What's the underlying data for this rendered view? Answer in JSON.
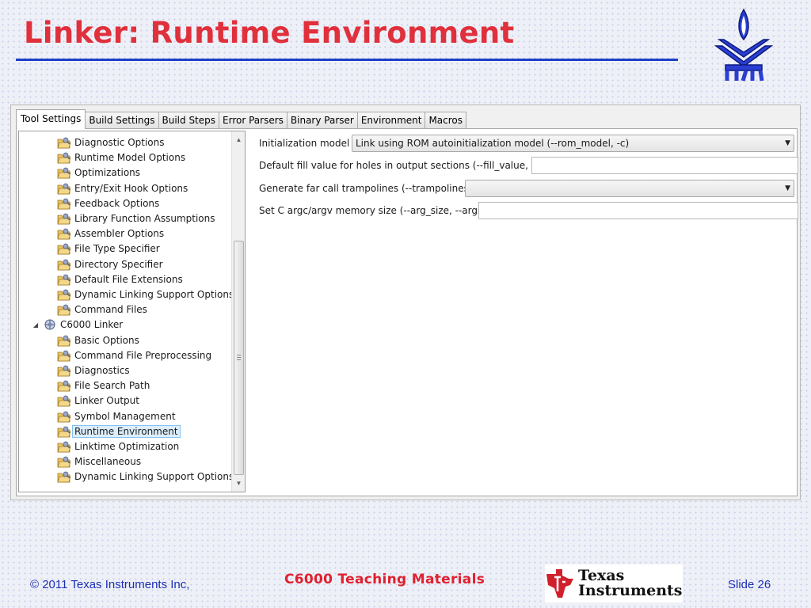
{
  "slide": {
    "title": "Linker: Runtime Environment",
    "footer_left": "© 2011 Texas Instruments Inc,",
    "footer_center": "C6000 Teaching Materials",
    "slide_number": "Slide 26",
    "ti_logo_line1": "Texas",
    "ti_logo_line2": "Instruments",
    "title_color": "#e0303c",
    "rule_color": "#1b3fc7"
  },
  "tabs": [
    {
      "label": "Tool Settings",
      "active": true
    },
    {
      "label": "Build Settings"
    },
    {
      "label": "Build Steps"
    },
    {
      "label": "Error Parsers"
    },
    {
      "label": "Binary Parser"
    },
    {
      "label": "Environment"
    },
    {
      "label": "Macros"
    }
  ],
  "tree": {
    "items": [
      {
        "label": "Diagnostic Options",
        "icon": "options-folder-icon"
      },
      {
        "label": "Runtime Model Options",
        "icon": "options-folder-icon"
      },
      {
        "label": "Optimizations",
        "icon": "options-folder-icon"
      },
      {
        "label": "Entry/Exit Hook Options",
        "icon": "options-folder-icon"
      },
      {
        "label": "Feedback Options",
        "icon": "options-folder-icon"
      },
      {
        "label": "Library Function Assumptions",
        "icon": "options-folder-icon"
      },
      {
        "label": "Assembler Options",
        "icon": "options-folder-icon"
      },
      {
        "label": "File Type Specifier",
        "icon": "options-folder-icon"
      },
      {
        "label": "Directory Specifier",
        "icon": "options-folder-icon"
      },
      {
        "label": "Default File Extensions",
        "icon": "options-folder-icon"
      },
      {
        "label": "Dynamic Linking Support Options",
        "icon": "options-folder-icon"
      },
      {
        "label": "Command Files",
        "icon": "options-folder-icon"
      },
      {
        "label": "C6000 Linker",
        "icon": "linker-tool-icon",
        "expanded": true
      },
      {
        "label": "Basic Options",
        "icon": "options-folder-icon"
      },
      {
        "label": "Command File Preprocessing",
        "icon": "options-folder-icon"
      },
      {
        "label": "Diagnostics",
        "icon": "options-folder-icon"
      },
      {
        "label": "File Search Path",
        "icon": "options-folder-icon"
      },
      {
        "label": "Linker Output",
        "icon": "options-folder-icon"
      },
      {
        "label": "Symbol Management",
        "icon": "options-folder-icon"
      },
      {
        "label": "Runtime Environment",
        "icon": "options-folder-icon",
        "selected": true
      },
      {
        "label": "Linktime Optimization",
        "icon": "options-folder-icon"
      },
      {
        "label": "Miscellaneous",
        "icon": "options-folder-icon"
      },
      {
        "label": "Dynamic Linking Support Options",
        "icon": "options-folder-icon"
      }
    ]
  },
  "settings": {
    "init_model_label": "Initialization model",
    "init_model_value": "Link using ROM autoinitialization model (--rom_model, -c)",
    "fill_value_label": "Default fill value for holes in output sections (--fill_value, -f)",
    "fill_value_value": "",
    "trampolines_label": "Generate far call trampolines (--trampolines)",
    "trampolines_value": "",
    "arg_size_label": "Set C argc/argv memory size (--arg_size, --args)",
    "arg_size_value": ""
  }
}
